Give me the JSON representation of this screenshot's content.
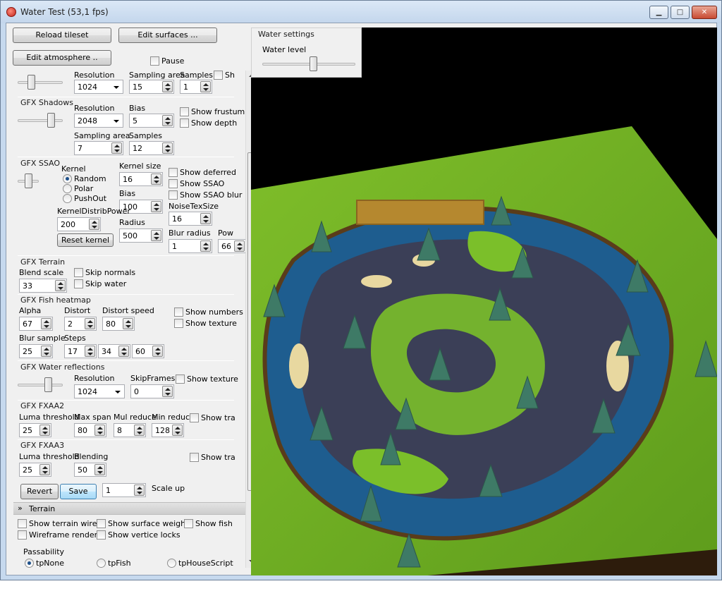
{
  "window": {
    "title": "Water Test (53,1 fps)",
    "min_label": "▁",
    "max_label": "□",
    "close_label": "✕"
  },
  "top_buttons": {
    "reload": "Reload tileset",
    "edit_surfaces": "Edit surfaces ...",
    "edit_atmosphere": "Edit atmosphere ..",
    "pause": "Pause"
  },
  "water_settings": {
    "title": "Water settings",
    "level_label": "Water level",
    "level_value": 0.55
  },
  "gfx_top": {
    "resolution_label": "Resolution",
    "resolution": "1024",
    "sampling_area_label": "Sampling area",
    "sampling_area": "15",
    "samples_label": "Samples",
    "samples": "1",
    "sh_label": "Sh"
  },
  "gfx_shadows": {
    "title": "GFX Shadows",
    "resolution_label": "Resolution",
    "resolution": "2048",
    "bias_label": "Bias",
    "bias": "5",
    "sampling_area_label": "Sampling area",
    "sampling_area": "7",
    "samples_label": "Samples",
    "samples": "12",
    "show_frustum": "Show frustum",
    "show_depth": "Show depth"
  },
  "gfx_ssao": {
    "title": "GFX SSAO",
    "kernel_label": "Kernel",
    "random": "Random",
    "polar": "Polar",
    "pushout": "PushOut",
    "kernel_size_label": "Kernel size",
    "kernel_size": "16",
    "bias_label": "Bias",
    "bias": "100",
    "radius_label": "Radius",
    "radius": "500",
    "kernel_distrib_label": "KernelDistribPower",
    "kernel_distrib": "200",
    "reset_kernel": "Reset kernel",
    "show_deferred": "Show deferred",
    "show_ssao": "Show SSAO",
    "show_ssao_blur": "Show SSAO blur",
    "noise_tex_label": "NoiseTexSize",
    "noise_tex": "16",
    "blur_radius_label": "Blur radius",
    "blur_radius": "1",
    "pow_label": "Pow",
    "pow": "66"
  },
  "gfx_terrain": {
    "title": "GFX Terrain",
    "blend_scale_label": "Blend scale",
    "blend_scale": "33",
    "skip_normals": "Skip normals",
    "skip_water": "Skip water"
  },
  "gfx_fish": {
    "title": "GFX Fish heatmap",
    "alpha_label": "Alpha",
    "alpha": "67",
    "distort_label": "Distort",
    "distort": "2",
    "distort_speed_label": "Distort speed",
    "distort_speed": "80",
    "show_numbers": "Show numbers",
    "show_texture": "Show texture",
    "blur_sample_label": "Blur sample",
    "blur_sample": "25",
    "steps_label": "Steps",
    "steps1": "17",
    "steps2": "34",
    "steps3": "60"
  },
  "gfx_water_refl": {
    "title": "GFX Water reflections",
    "resolution_label": "Resolution",
    "resolution": "1024",
    "skip_frames_label": "SkipFrames",
    "skip_frames": "0",
    "show_texture": "Show texture"
  },
  "gfx_fxaa2": {
    "title": "GFX FXAA2",
    "luma_label": "Luma threshold",
    "luma": "25",
    "max_span_label": "Max span",
    "max_span": "80",
    "mul_reduce_label": "Mul reduce",
    "mul_reduce": "8",
    "min_reduce_label": "Min reduce",
    "min_reduce": "128",
    "show_tra": "Show tra"
  },
  "gfx_fxaa3": {
    "title": "GFX FXAA3",
    "luma_label": "Luma threshold",
    "luma": "25",
    "blending_label": "Blending",
    "blending": "50",
    "show_tra": "Show tra"
  },
  "actions": {
    "revert": "Revert",
    "save": "Save",
    "scale_value": "1",
    "scale_label": "Scale up"
  },
  "terrain": {
    "title": "Terrain",
    "show_terrain_wires": "Show terrain wires",
    "show_surface_weights": "Show surface weights",
    "show_fish": "Show fish",
    "wireframe_render": "Wireframe render",
    "show_vertice_locks": "Show vertice locks",
    "passability_label": "Passability",
    "tp_none": "tpNone",
    "tp_fish": "tpFish",
    "tp_house": "tpHouseScript"
  }
}
